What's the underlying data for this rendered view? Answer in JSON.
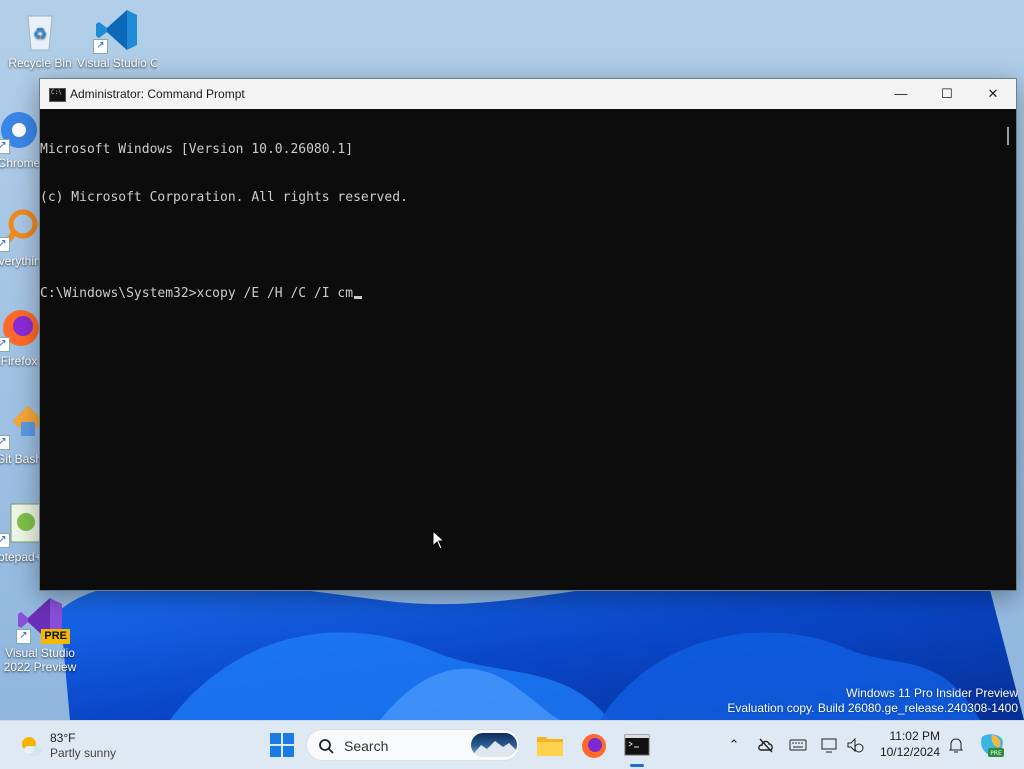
{
  "desktop": {
    "icons": [
      {
        "label": "Recycle Bin"
      },
      {
        "label": "Visual Studio Code"
      },
      {
        "label": "Chrome"
      },
      {
        "label": "Everything"
      },
      {
        "label": "Firefox"
      },
      {
        "label": "Git Bash"
      },
      {
        "label": "Notepad++"
      },
      {
        "label": "Visual Studio 2022 Preview",
        "badge": "PRE"
      }
    ],
    "watermark": {
      "line1": "Windows 11 Pro Insider Preview",
      "line2": "Evaluation copy. Build 26080.ge_release.240308-1400"
    }
  },
  "window": {
    "title": "Administrator: Command Prompt",
    "controls": {
      "minimize": "—",
      "maximize": "☐",
      "close": "✕"
    },
    "console_lines": [
      "Microsoft Windows [Version 10.0.26080.1]",
      "(c) Microsoft Corporation. All rights reserved.",
      "",
      "C:\\Windows\\System32>xcopy /E /H /C /I cm"
    ]
  },
  "taskbar": {
    "weather": {
      "temp": "83°F",
      "desc": "Partly sunny"
    },
    "search_placeholder": "Search",
    "pinned": [
      "start-button",
      "search-box",
      "file-explorer",
      "firefox",
      "command-prompt"
    ],
    "clock": {
      "time": "11:02 PM",
      "date": "10/12/2024"
    }
  },
  "colors": {
    "console_bg": "#0c0c0c",
    "console_fg": "#cccccc",
    "accent": "#1a6fd6"
  }
}
